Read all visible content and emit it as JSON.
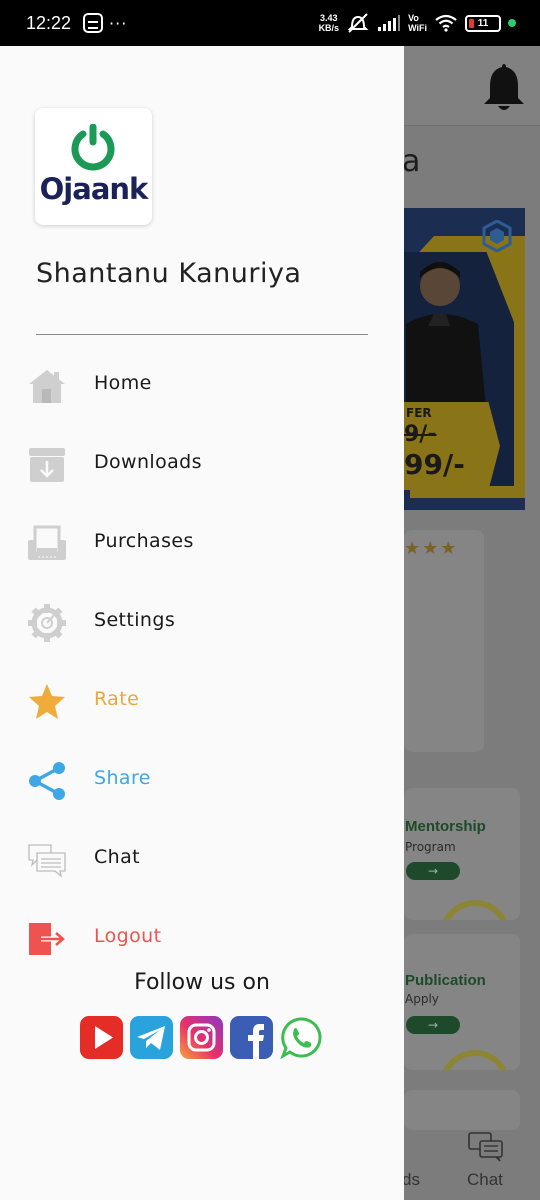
{
  "status_bar": {
    "time": "12:22",
    "more": "···",
    "net_speed_value": "3.43",
    "net_speed_unit": "KB/s",
    "vowifi_top": "Vo",
    "vowifi_bottom": "WiFi",
    "battery": "11"
  },
  "drawer": {
    "logo_text": "Ojaank",
    "user_name": "Shantanu Kanuriya",
    "menu": [
      {
        "label": "Home",
        "icon": "home-icon",
        "color": "#1a1a1a"
      },
      {
        "label": "Downloads",
        "icon": "downloads-icon",
        "color": "#1a1a1a"
      },
      {
        "label": "Purchases",
        "icon": "purchases-icon",
        "color": "#1a1a1a"
      },
      {
        "label": "Settings",
        "icon": "settings-icon",
        "color": "#1a1a1a"
      },
      {
        "label": "Rate",
        "icon": "star-icon",
        "color": "#e7a93c"
      },
      {
        "label": "Share",
        "icon": "share-icon",
        "color": "#3fa7e6"
      },
      {
        "label": "Chat",
        "icon": "chat-icon",
        "color": "#1a1a1a"
      },
      {
        "label": "Logout",
        "icon": "logout-icon",
        "color": "#ef5350"
      }
    ],
    "follow_text": "Follow us on",
    "socials": [
      "youtube-icon",
      "telegram-icon",
      "instagram-icon",
      "facebook-icon",
      "whatsapp-icon"
    ]
  },
  "background": {
    "heading_fragment": "a",
    "offer_label": "FER",
    "price_old": "9/-",
    "price_new": "99/-",
    "stars": "★★★",
    "card1_title": "Mentorship",
    "card1_sub": "Program",
    "card2_title": "Publication",
    "card2_sub": "Apply",
    "button_arrow": "→",
    "bottom_left_fragment": "ds",
    "bottom_chat": "Chat"
  }
}
